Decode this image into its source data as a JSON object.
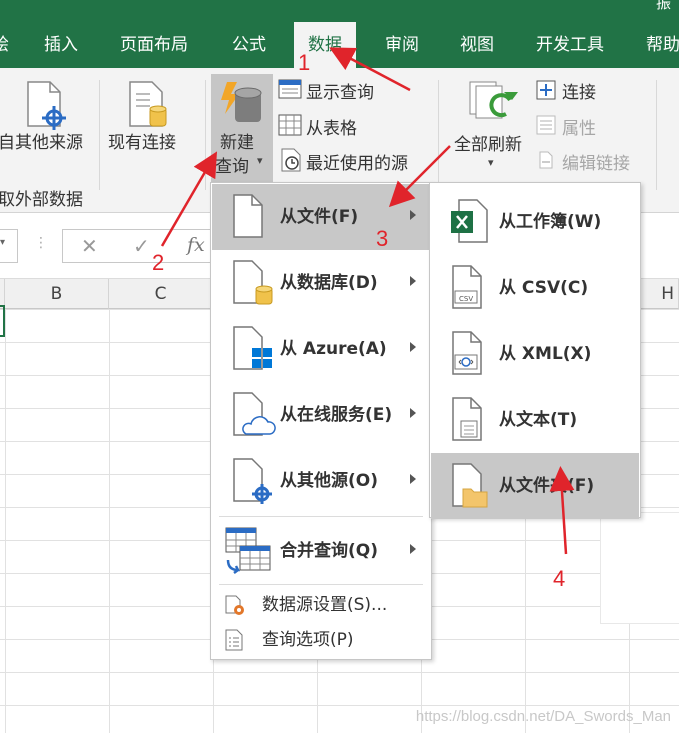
{
  "ribbon_tabs": [
    "绘",
    "插入",
    "页面布局",
    "公式",
    "数据",
    "审阅",
    "视图",
    "开发工具",
    "帮助"
  ],
  "window_corner": "振",
  "get_external_data": {
    "from_other_sources": "自其他来源",
    "existing_connections": "现有连接",
    "group_label": "取外部数据"
  },
  "get_transform": {
    "new_query_line1": "新建",
    "new_query_line2": "查询",
    "show_queries": "显示查询",
    "from_table": "从表格",
    "recent_sources": "最近使用的源"
  },
  "connections": {
    "refresh_all": "全部刷新",
    "connections": "连接",
    "properties": "属性",
    "edit_links": "编辑链接"
  },
  "formula_bar": {
    "fx": "fx"
  },
  "column_headers": [
    "B",
    "C",
    "H"
  ],
  "new_query_menu": {
    "items": [
      "从文件(F)",
      "从数据库(D)",
      "从 Azure(A)",
      "从在线服务(E)",
      "从其他源(O)",
      "合并查询(Q)"
    ],
    "small_items": [
      "数据源设置(S)...",
      "查询选项(P)"
    ]
  },
  "from_file_menu": {
    "items": [
      "从工作簿(W)",
      "从 CSV(C)",
      "从 XML(X)",
      "从文本(T)",
      "从文件夹(F)"
    ],
    "csv_icon_text": "CSV"
  },
  "annotations": [
    "1",
    "2",
    "3",
    "4"
  ],
  "watermark": "https://blog.csdn.net/DA_Swords_Man",
  "colors": {
    "excel_green": "#217346",
    "annotation_red": "#e0242b",
    "highlight": "#c8c8c8"
  }
}
